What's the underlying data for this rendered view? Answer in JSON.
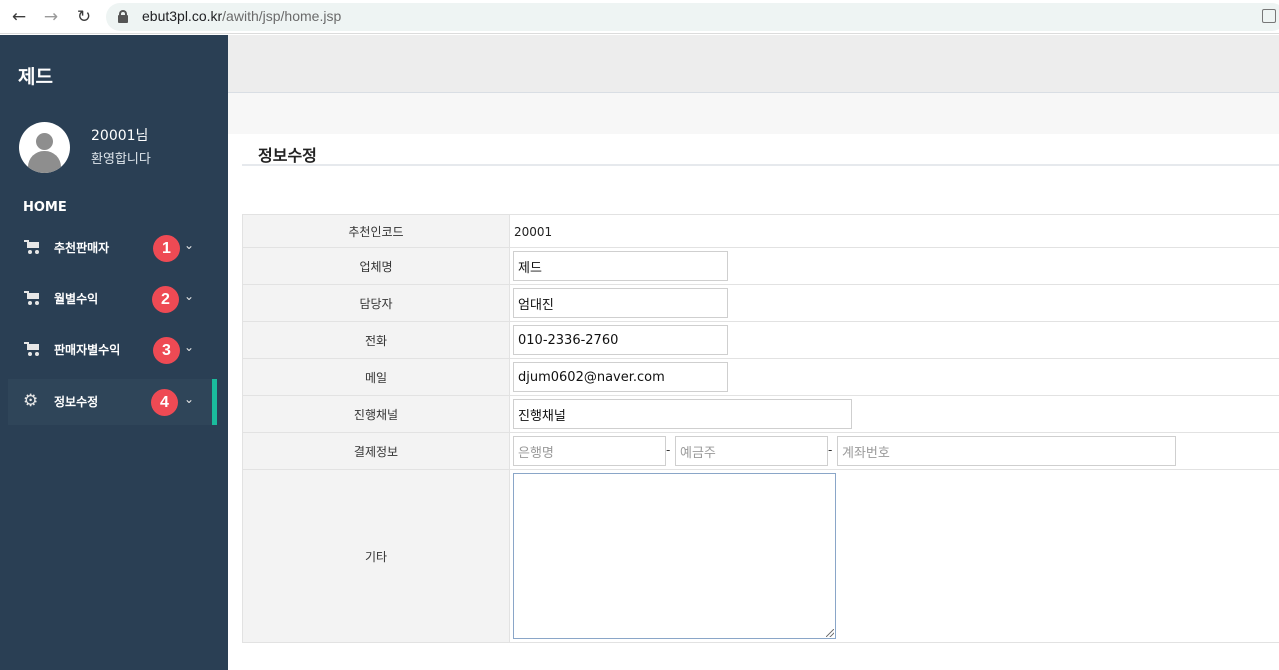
{
  "browser": {
    "url_domain": "ebut3pl.co.kr",
    "url_path": "/awith/jsp/home.jsp"
  },
  "sidebar": {
    "brand": "제드",
    "user": {
      "id": "20001님",
      "welcome": "환영합니다"
    },
    "home_label": "HOME",
    "items": [
      {
        "label": "추천판매자",
        "icon": "cart-icon",
        "badge": "1"
      },
      {
        "label": "월별수익",
        "icon": "cart-icon",
        "badge": "2"
      },
      {
        "label": "판매자별수익",
        "icon": "cart-icon",
        "badge": "3"
      },
      {
        "label": "정보수정",
        "icon": "gear-icon",
        "badge": "4",
        "active": true
      }
    ],
    "accent_color": "#1abb9c",
    "badge_color": "#ee4a54"
  },
  "main": {
    "title": "정보수정",
    "form": {
      "referral_code": {
        "label": "추천인코드",
        "value": "20001"
      },
      "company_name": {
        "label": "업체명",
        "value": "제드"
      },
      "manager": {
        "label": "담당자",
        "value": "엄대진"
      },
      "phone": {
        "label": "전화",
        "value": "010-2336-2760"
      },
      "email": {
        "label": "메일",
        "value": "djum0602@naver.com"
      },
      "channel": {
        "label": "진행채널",
        "value": "진행채널"
      },
      "payment": {
        "label": "결제정보",
        "bank_placeholder": "은행명",
        "holder_placeholder": "예금주",
        "account_placeholder": "계좌번호",
        "separator": "-"
      },
      "etc": {
        "label": "기타",
        "value": ""
      }
    }
  }
}
